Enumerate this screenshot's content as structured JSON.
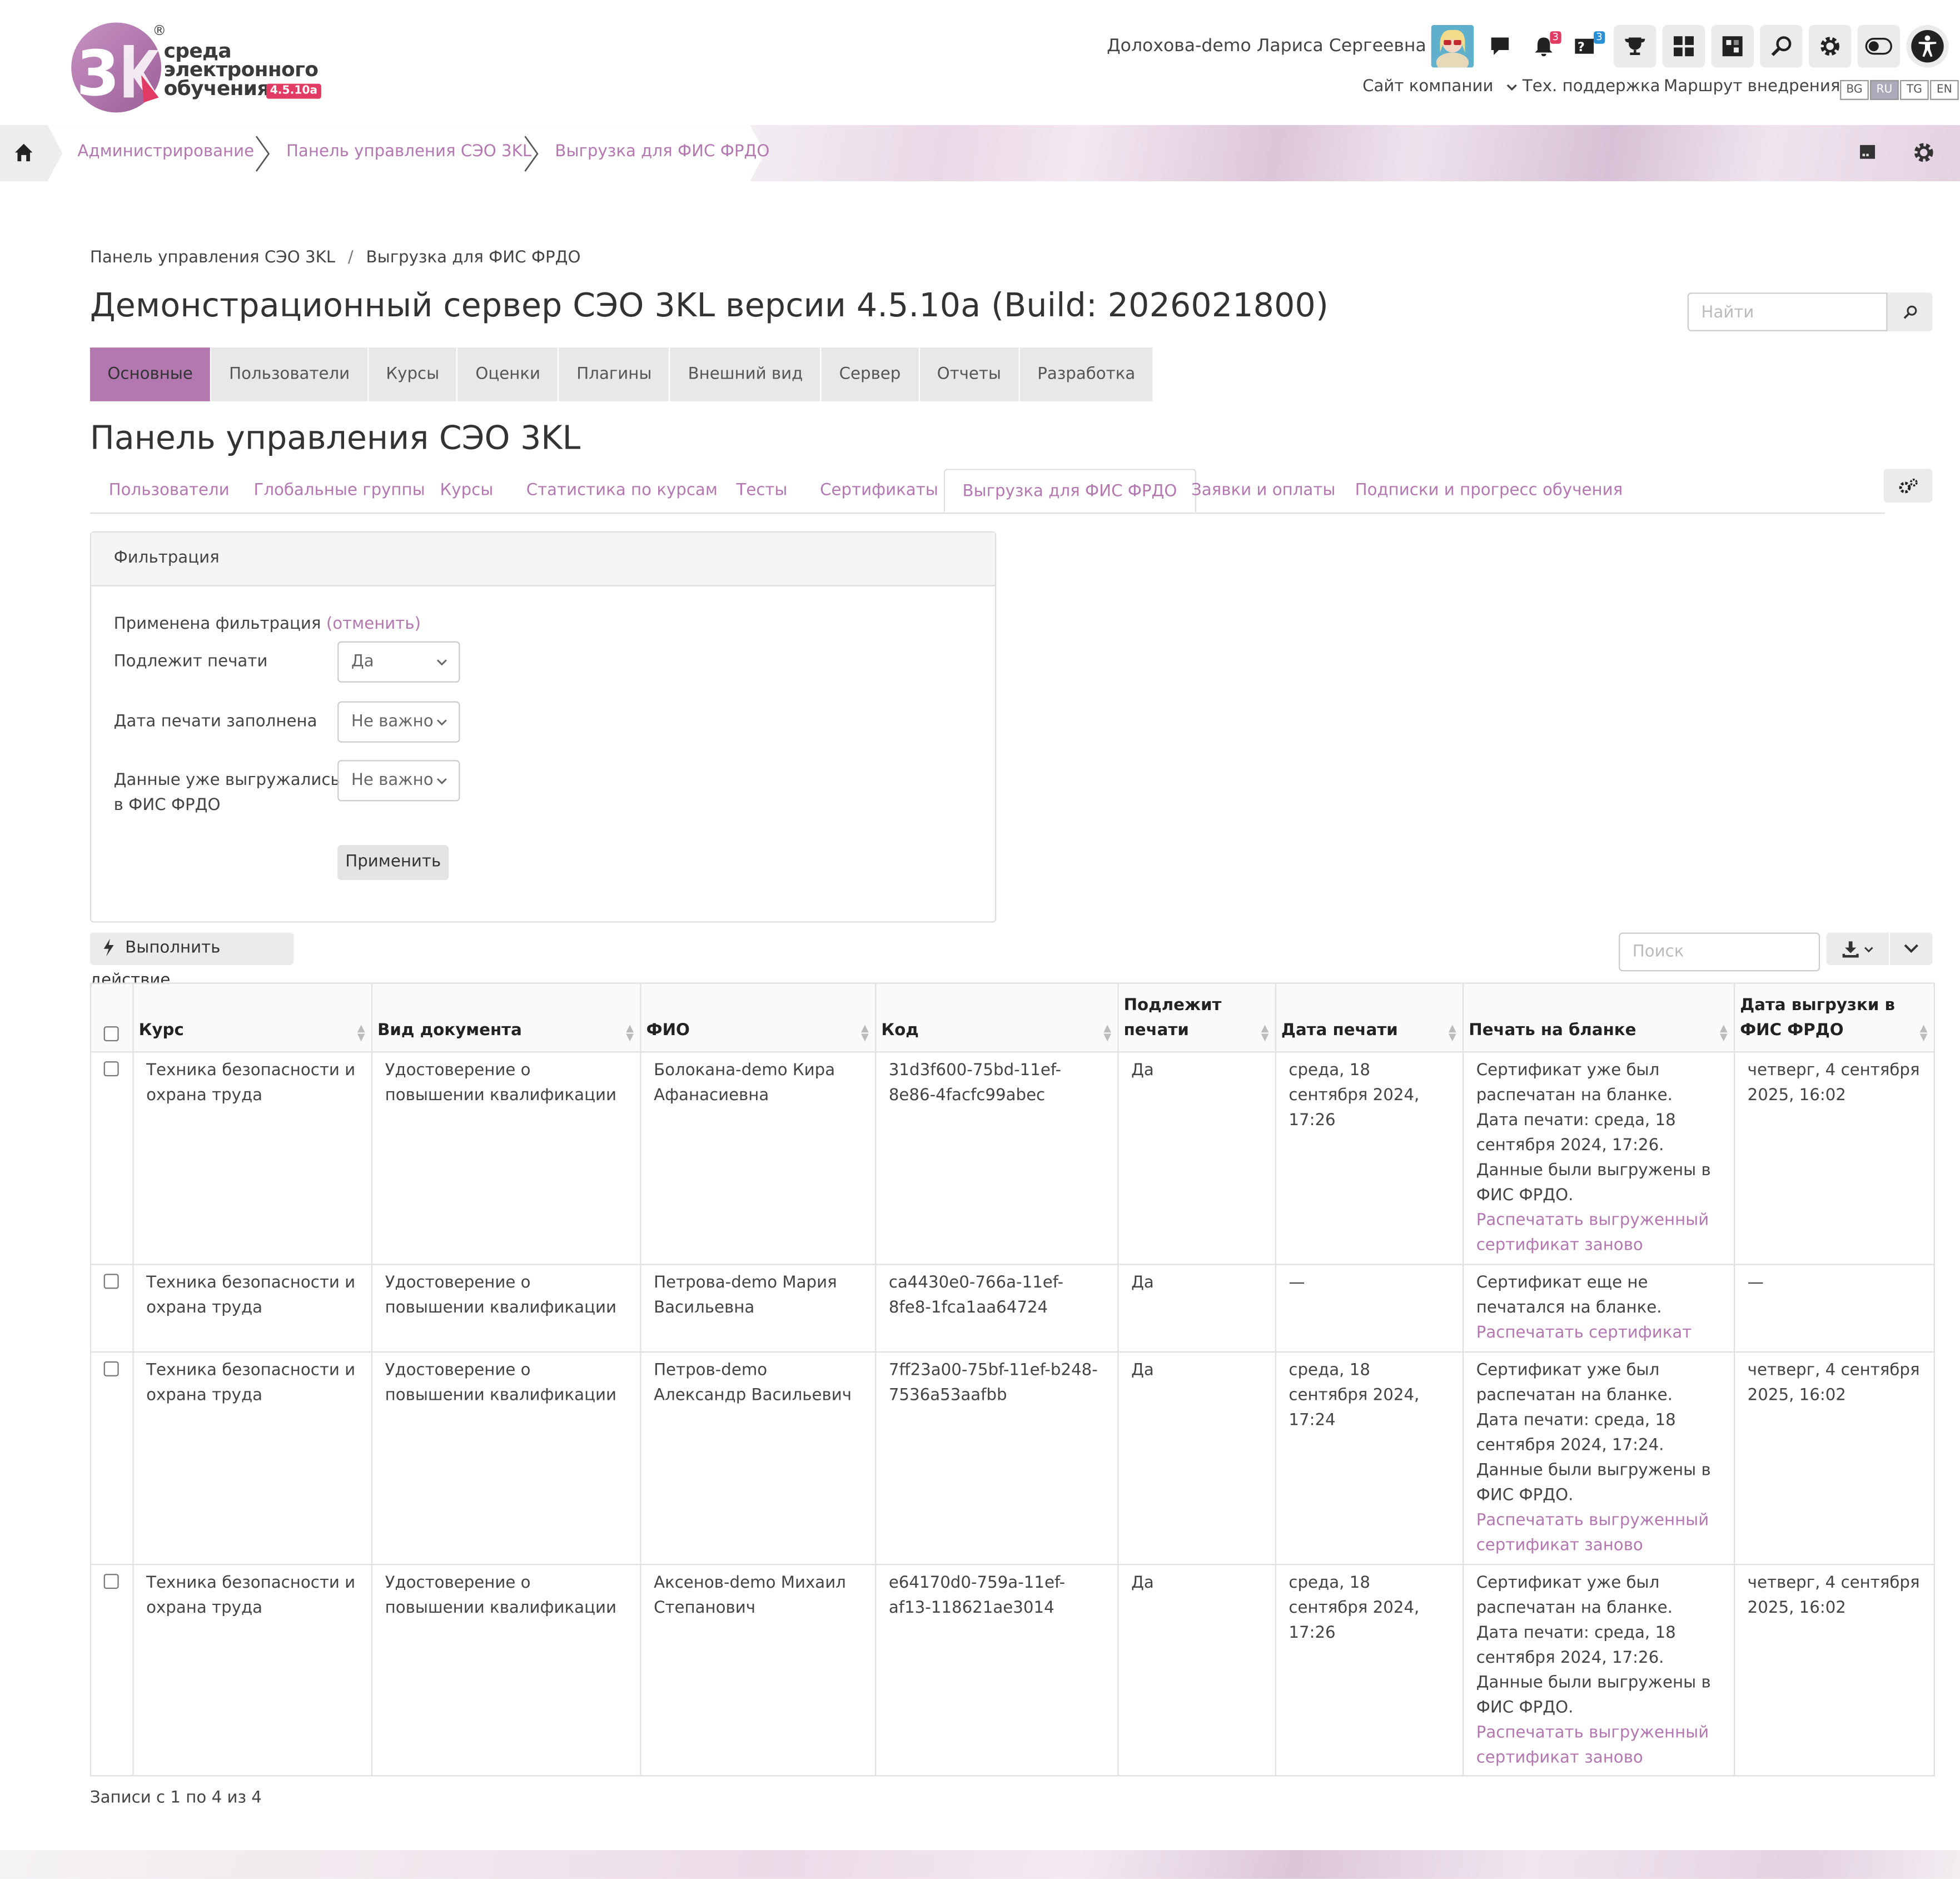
{
  "logo": {
    "line1": "среда",
    "line2": "электронного",
    "line3": "обучения",
    "version": "4.5.10a",
    "reg": "®"
  },
  "header": {
    "user_name": "Долохова-demo Лариса Сергеевна",
    "notifications_count": "3",
    "messages_count": "3",
    "nav": {
      "company_site": "Сайт компании",
      "support": "Тех. поддержка",
      "route": "Маршрут внедрения"
    },
    "languages": [
      "BG",
      "RU",
      "TG",
      "EN"
    ],
    "active_language": "RU"
  },
  "breadcrumb": [
    "Администрирование",
    "Панель управления СЭО 3KL",
    "Выгрузка для ФИС ФРДО"
  ],
  "page": {
    "breadcrumb2": {
      "parent": "Панель управления СЭО 3KL",
      "sep": "/",
      "current": "Выгрузка для ФИС ФРДО"
    },
    "title": "Демонстрационный сервер СЭО 3KL версии 4.5.10a (Build: 2026021800)",
    "search_placeholder": "Найти",
    "main_tabs": [
      "Основные",
      "Пользователи",
      "Курсы",
      "Оценки",
      "Плагины",
      "Внешний вид",
      "Сервер",
      "Отчеты",
      "Разработка"
    ],
    "section_title": "Панель управления СЭО 3KL",
    "sub_tabs": [
      "Пользователи",
      "Глобальные группы",
      "Курсы",
      "Статистика по курсам",
      "Тесты",
      "Сертификаты",
      "Выгрузка для ФИС ФРДО",
      "Заявки и оплаты",
      "Подписки и прогресс обучения"
    ]
  },
  "filter": {
    "header": "Фильтрация",
    "applied": "Применена фильтрация",
    "cancel": "(отменить)",
    "fields": [
      {
        "label": "Подлежит печати",
        "value": "Да"
      },
      {
        "label": "Дата печати заполнена",
        "value": "Не важно"
      },
      {
        "label1": "Данные уже выгружались",
        "label2": "в ФИС ФРДО",
        "value": "Не важно"
      }
    ],
    "apply": "Применить"
  },
  "actions": {
    "run_action": "Выполнить действие",
    "search_placeholder": "Поиск"
  },
  "table": {
    "headers": {
      "course": "Курс",
      "doc_type": "Вид документа",
      "fio": "ФИО",
      "code": "Код",
      "to_print_1": "Подлежит",
      "to_print_2": "печати",
      "print_date": "Дата печати",
      "print_on_blank": "Печать на бланке",
      "export_date_1": "Дата выгрузки в",
      "export_date_2": "ФИС ФРДО"
    },
    "rows": [
      {
        "course": "Техника безопасности и охрана труда",
        "doc_type": "Удостоверение о повышении квалификации",
        "fio": "Болокана-demo Кира Афанасиевна",
        "code": "31d3f600-75bd-11ef-8e86-4facfc99abec",
        "to_print": "Да",
        "print_date": "среда, 18 сентября 2024, 17:26",
        "status": "Сертификат уже был распечатан на бланке.",
        "status2": "Дата печати: среда, 18 сентября 2024, 17:26.",
        "status3": "Данные были выгружены в ФИС ФРДО.",
        "link": "Распечатать выгруженный сертификат заново",
        "export_date": "четверг, 4 сентября 2025, 16:02"
      },
      {
        "course": "Техника безопасности и охрана труда",
        "doc_type": "Удостоверение о повышении квалификации",
        "fio": "Петрова-demo Мария Васильевна",
        "code": "ca4430e0-766a-11ef-8fe8-1fca1aa64724",
        "to_print": "Да",
        "print_date": "—",
        "status": "Сертификат еще не печатался на бланке.",
        "status2": "",
        "status3": "",
        "link": "Распечатать сертификат",
        "export_date": "—"
      },
      {
        "course": "Техника безопасности и охрана труда",
        "doc_type": "Удостоверение о повышении квалификации",
        "fio": "Петров-demo Александр Васильевич",
        "code": "7ff23a00-75bf-11ef-b248-7536a53aafbb",
        "to_print": "Да",
        "print_date": "среда, 18 сентября 2024, 17:24",
        "status": "Сертификат уже был распечатан на бланке.",
        "status2": "Дата печати: среда, 18 сентября 2024, 17:24.",
        "status3": "Данные были выгружены в ФИС ФРДО.",
        "link": "Распечатать выгруженный сертификат заново",
        "export_date": "четверг, 4 сентября 2025, 16:02"
      },
      {
        "course": "Техника безопасности и охрана труда",
        "doc_type": "Удостоверение о повышении квалификации",
        "fio": "Аксенов-demo Михаил Степанович",
        "code": "e64170d0-759a-11ef-af13-118621ae3014",
        "to_print": "Да",
        "print_date": "среда, 18 сентября 2024, 17:26",
        "status": "Сертификат уже был распечатан на бланке.",
        "status2": "Дата печати: среда, 18 сентября 2024, 17:26.",
        "status3": "Данные были выгружены в ФИС ФРДО.",
        "link": "Распечатать выгруженный сертификат заново",
        "export_date": "четверг, 4 сентября 2025, 16:02"
      }
    ],
    "footer": "Записи с 1 по 4 из 4"
  },
  "colors": {
    "accent": "#b378b0",
    "tab_active": "#b378b0",
    "badge_red": "#e23b63",
    "badge_blue": "#2a8fd6"
  }
}
